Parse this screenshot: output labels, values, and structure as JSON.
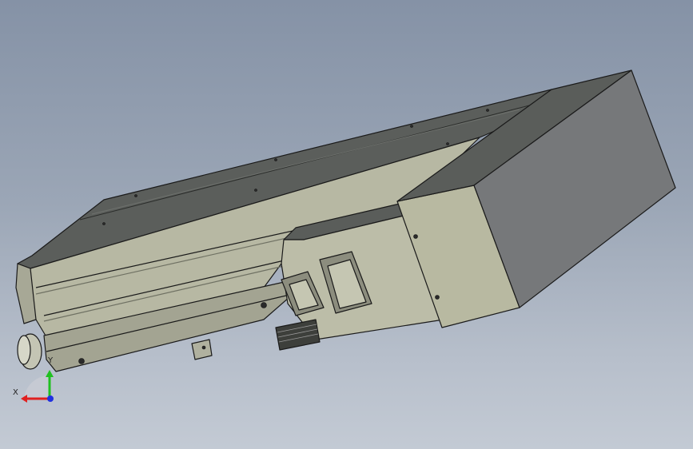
{
  "viewport": {
    "background_top": "#8592a6",
    "background_bottom": "#c3cad4"
  },
  "model": {
    "body_color": "#b9baa5",
    "body_dark": "#6c6e62",
    "top_color": "#5a5d5b",
    "motor_front": "#b9baa2",
    "motor_side": "#77797a",
    "edge_color": "#1a1a1a"
  },
  "triad": {
    "x_label": "X",
    "y_label": "Y",
    "x_color": "#e02020",
    "y_color": "#20c020",
    "z_color": "#2030e0"
  }
}
